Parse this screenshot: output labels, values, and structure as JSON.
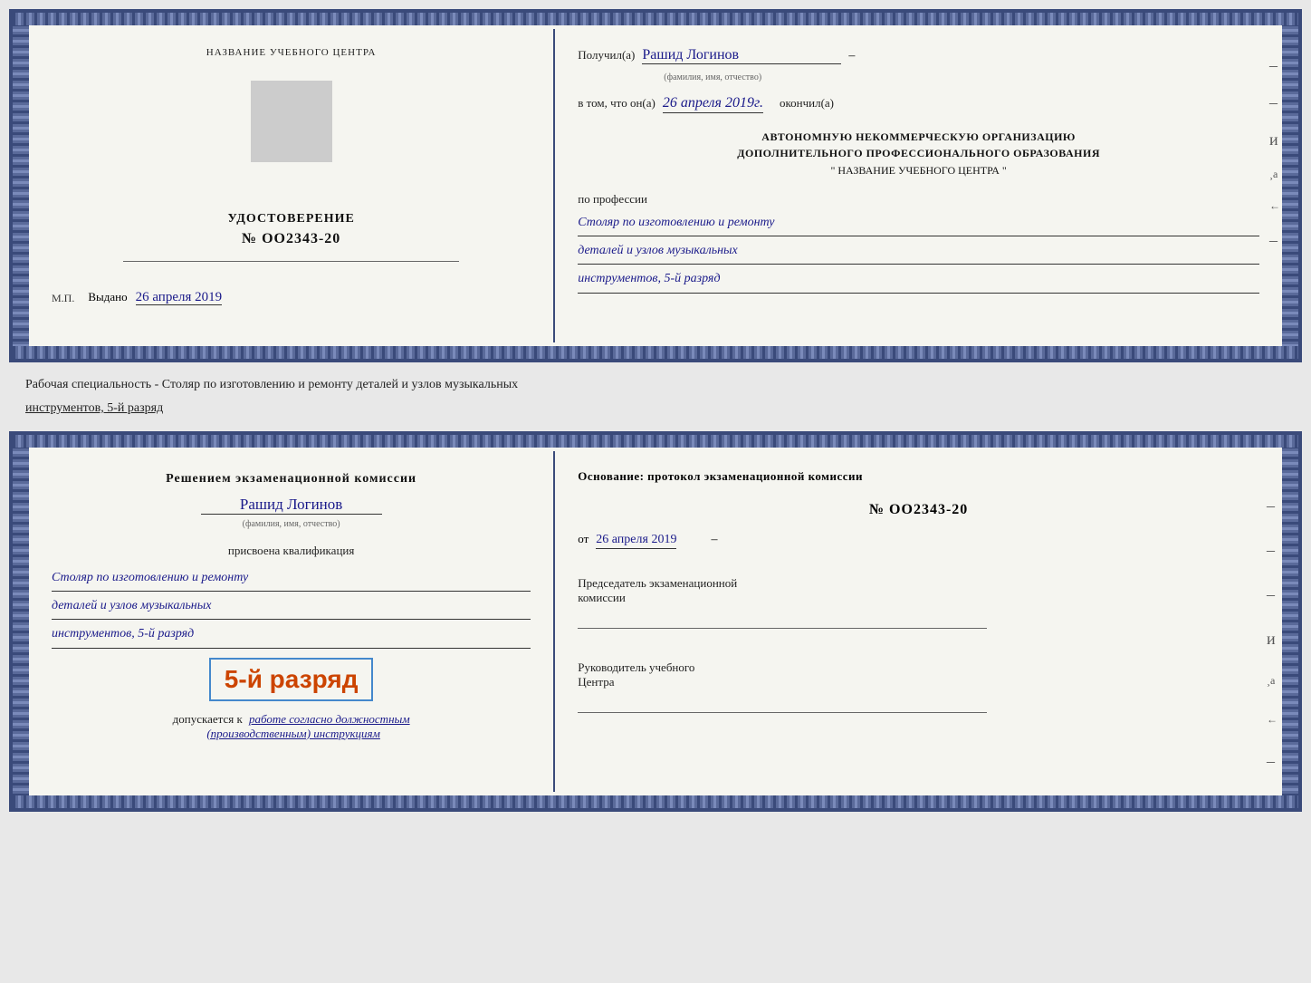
{
  "doc1": {
    "left": {
      "org_label": "НАЗВАНИЕ УЧЕБНОГО ЦЕНТРА",
      "cert_title": "УДОСТОВЕРЕНИЕ",
      "cert_number": "№ OO2343-20",
      "issued_label": "Выдано",
      "issued_date": "26 апреля 2019",
      "mp_label": "М.П."
    },
    "right": {
      "received_label": "Получил(а)",
      "name_value": "Рашид Логинов",
      "name_sublabel": "(фамилия, имя, отчество)",
      "dash": "–",
      "date_label": "в том, что он(а)",
      "date_value": "26 апреля 2019г.",
      "finished_label": "окончил(а)",
      "org_line1": "АВТОНОМНУЮ НЕКОММЕРЧЕСКУЮ ОРГАНИЗАЦИЮ",
      "org_line2": "ДОПОЛНИТЕЛЬНОГО ПРОФЕССИОНАЛЬНОГО ОБРАЗОВАНИЯ",
      "org_name": "\"  НАЗВАНИЕ УЧЕБНОГО ЦЕНТРА  \"",
      "profession_label": "по профессии",
      "profession_line1": "Столяр по изготовлению и ремонту",
      "profession_line2": "деталей и узлов музыкальных",
      "profession_line3": "инструментов, 5-й разряд"
    }
  },
  "between_label": "Рабочая специальность - Столяр по изготовлению и ремонту деталей и узлов музыкальных",
  "between_label2": "инструментов, 5-й разряд",
  "doc2": {
    "left": {
      "decision_label": "Решением экзаменационной комиссии",
      "name_value": "Рашид Логинов",
      "name_sublabel": "(фамилия, имя, отчество)",
      "qualification_label": "присвоена квалификация",
      "qual_line1": "Столяр по изготовлению и ремонту",
      "qual_line2": "деталей и узлов музыкальных",
      "qual_line3": "инструментов, 5-й разряд",
      "rank_highlight": "5-й разряд",
      "allowed_label": "допускается к",
      "allowed_value": "работе согласно должностным",
      "allowed_value2": "(производственным) инструкциям"
    },
    "right": {
      "basis_label": "Основание: протокол экзаменационной комиссии",
      "protocol_number": "№  OO2343-20",
      "date_prefix": "от",
      "date_value": "26 апреля 2019",
      "chairman_label": "Председатель экзаменационной",
      "chairman_label2": "комиссии",
      "director_label": "Руководитель учебного",
      "director_label2": "Центра"
    }
  }
}
